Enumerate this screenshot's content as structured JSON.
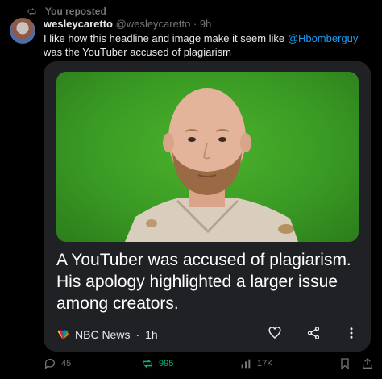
{
  "repost": {
    "label": "You reposted",
    "icon": "repost-icon"
  },
  "tweet": {
    "author_name": "wesleycaretto",
    "handle": "@wesleycaretto",
    "separator": "·",
    "time": "9h",
    "text_before": "I like how this headline and image make it seem like ",
    "mention": "@Hbomberguy",
    "text_after": " was the YouTuber accused of plagiarism"
  },
  "card": {
    "headline": "A YouTuber was accused of plagiarism. His apology highlighted a larger issue among creators.",
    "source": "NBC News",
    "dot": "·",
    "age": "1h",
    "icons": [
      "like-icon",
      "share-icon",
      "more-icon"
    ]
  },
  "actions": {
    "replies": "45",
    "reposts": "995",
    "views": "17K",
    "colors": {
      "muted": "#71767b",
      "repost_active": "#00ba7c",
      "link": "#1d9bf0"
    }
  }
}
